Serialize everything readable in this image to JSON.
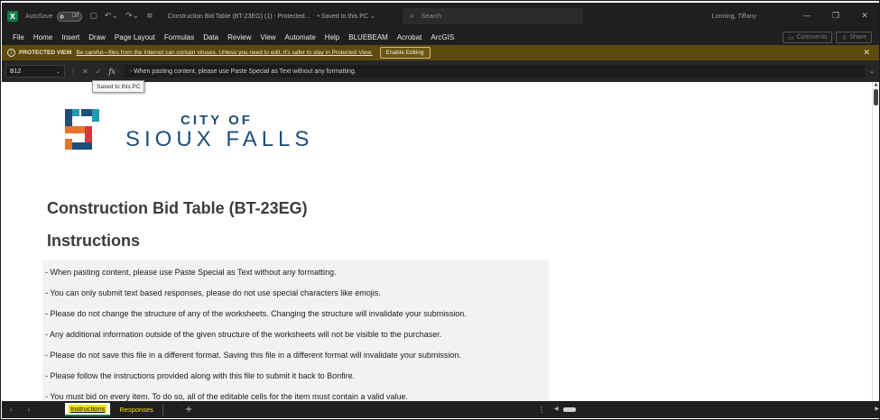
{
  "titlebar": {
    "app_icon": "X",
    "autosave_label": "AutoSave",
    "autosave_state": "Off",
    "document_title": "Construction Bid Table (BT-23EG) (1)  -  Protected...",
    "saved_status": "• Saved to this PC ⌄",
    "search_placeholder": "Search",
    "user_name": "Lonning, Tiffany",
    "icons": [
      "save-icon",
      "undo-icon",
      "redo-icon",
      "customize-icon"
    ]
  },
  "menu": {
    "items": [
      "File",
      "Home",
      "Insert",
      "Draw",
      "Page Layout",
      "Formulas",
      "Data",
      "Review",
      "View",
      "Automate",
      "Help",
      "BLUEBEAM",
      "Acrobat",
      "ArcGIS"
    ],
    "comments_label": "Comments",
    "share_label": "Share"
  },
  "protected_view": {
    "title": "PROTECTED VIEW",
    "message": "Be careful—files from the Internet can contain viruses. Unless you need to edit, it's safer to stay in Protected View.",
    "enable_label": "Enable Editing"
  },
  "formula_bar": {
    "cell_ref": "B12",
    "content": "- When pasting content, please use Paste Special as Text without any formatting.",
    "fx_label": "fx"
  },
  "tooltip": {
    "text": "Saved to this PC"
  },
  "sheet": {
    "logo_line1": "CITY OF",
    "logo_line2": "SIOUX FALLS",
    "title": "Construction Bid Table (BT-23EG)",
    "instructions_heading": "Instructions",
    "instructions": [
      "- When pasting content, please use Paste Special as Text without any formatting.",
      "- You can only submit text based responses, please do not use special characters like emojis.",
      "- Please do not change the structure of any of the worksheets. Changing the structure will invalidate your submission.",
      "- Any additional information outside of the given structure of the worksheets will not be visible to the purchaser.",
      "- Please do not save this file in a different format. Saving this file in a different format will invalidate your submission.",
      "- Please follow the instructions provided along with this file to submit it back to Bonfire.",
      "- You must bid on every item. To do so, all of the editable cells for the item must contain a valid value."
    ]
  },
  "tabs": {
    "items": [
      "Instructions",
      "Responses"
    ],
    "active": "Instructions",
    "add_label": "+"
  },
  "colors": {
    "excel_green": "#107c41",
    "protected_bar": "#5c4a0e",
    "logo_blue": "#1d4f7a",
    "logo_orange": "#e8742a",
    "logo_red": "#d33a3a",
    "logo_teal": "#1f9bb6",
    "tab_highlight": "#f5e600"
  }
}
